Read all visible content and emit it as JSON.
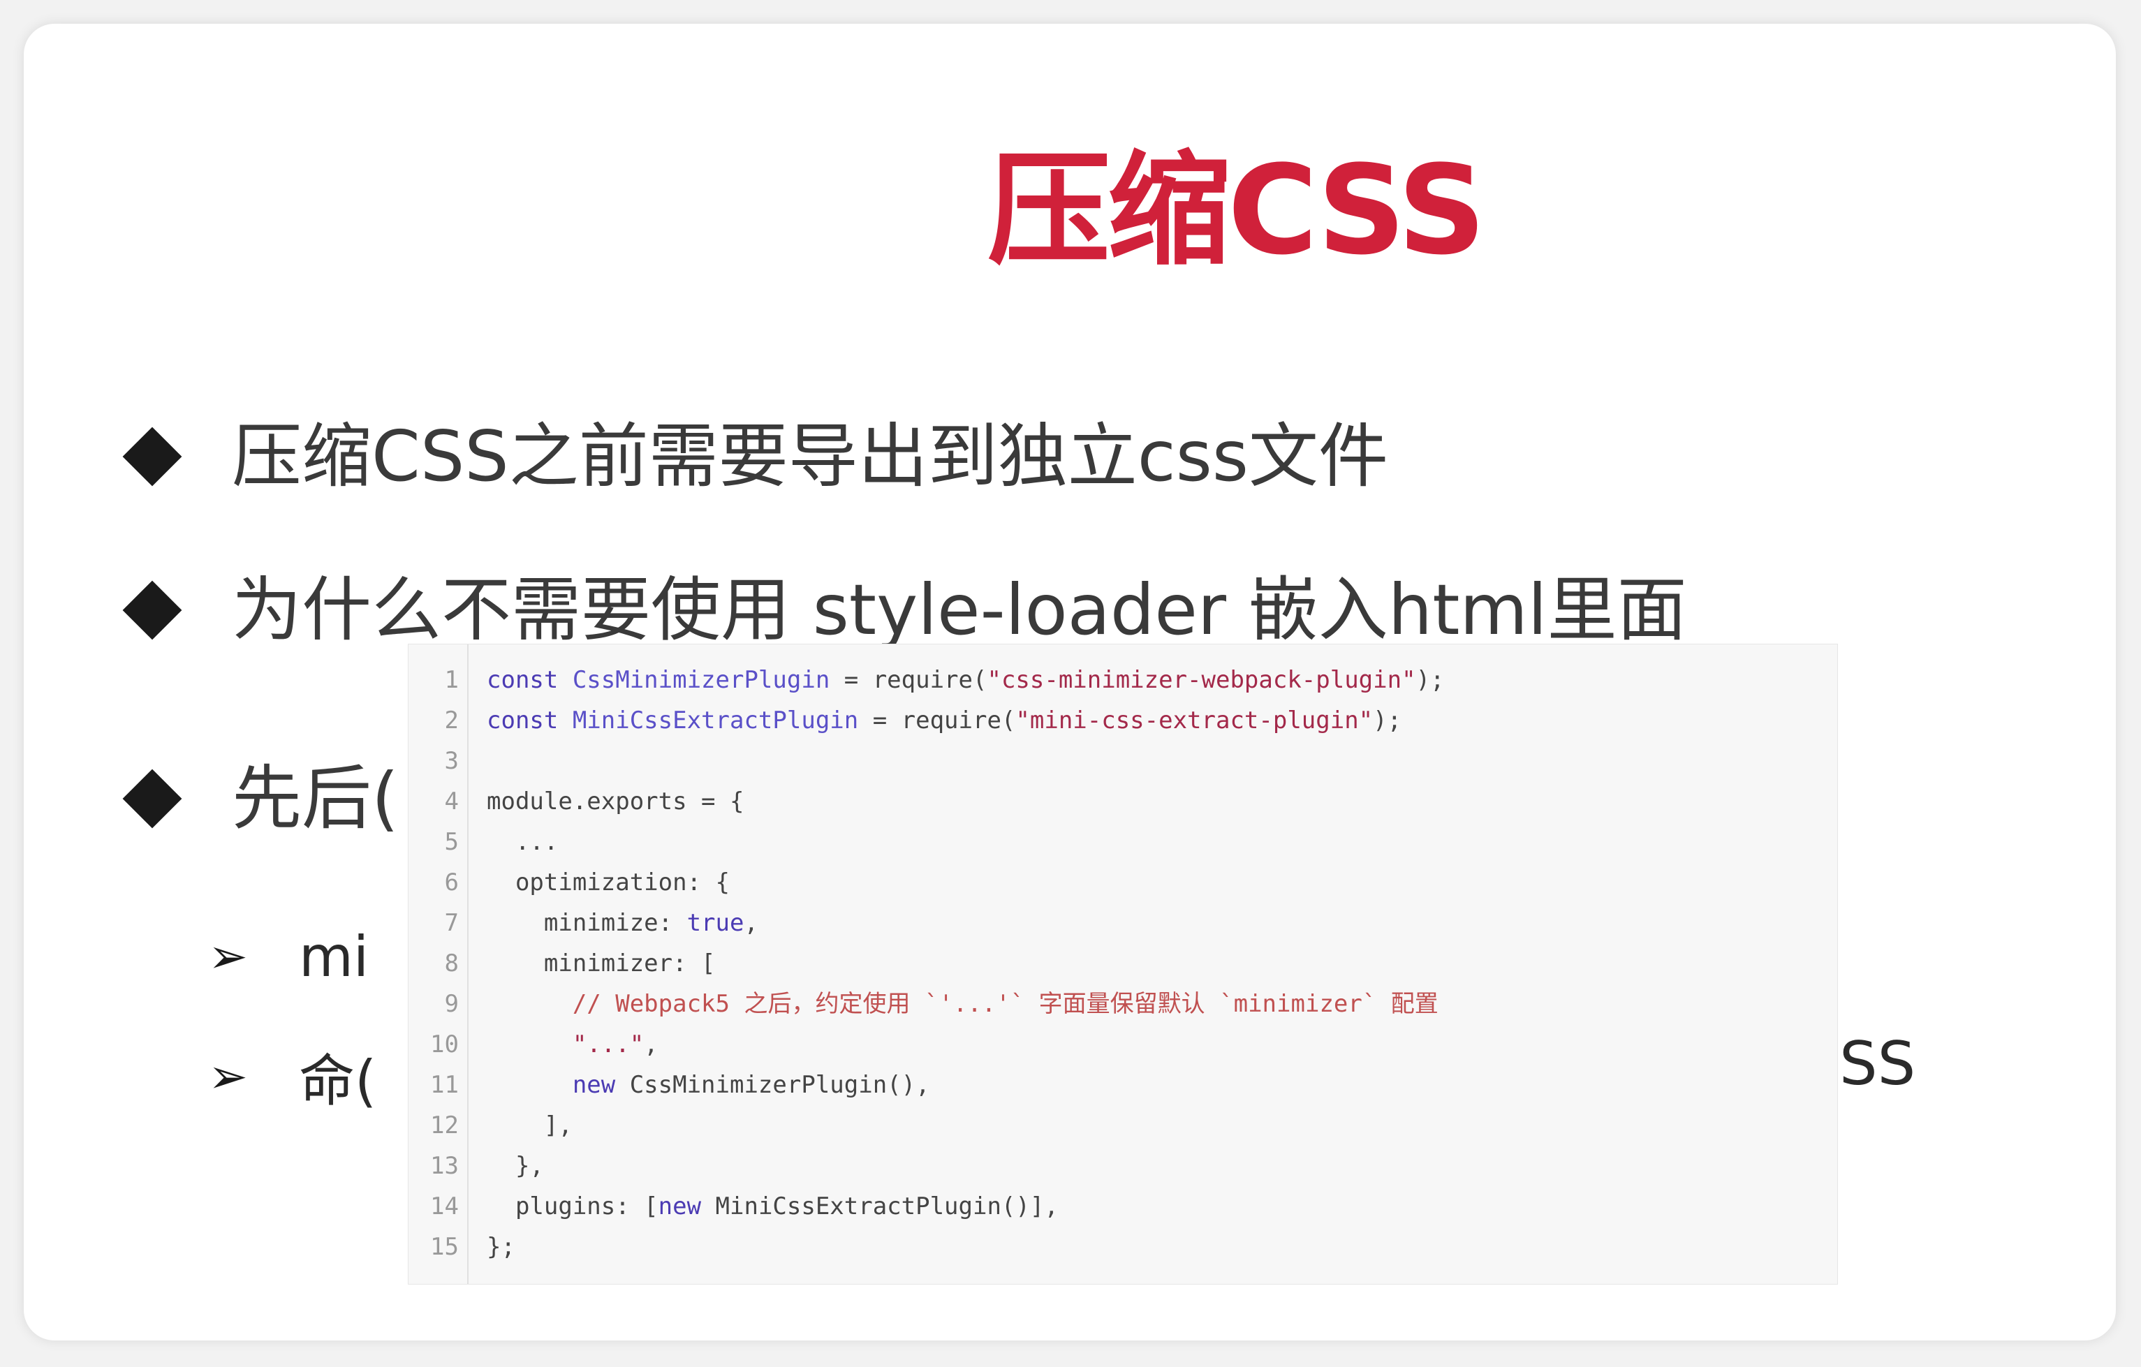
{
  "slide": {
    "title": "压缩CSS",
    "bullets": [
      {
        "text": "压缩CSS之前需要导出到独立css文件"
      },
      {
        "text": "为什么不需要使用 style-loader 嵌入html里面"
      },
      {
        "text": "先后("
      }
    ],
    "subbullets": [
      {
        "text": "mi"
      },
      {
        "text": "命("
      }
    ],
    "hidden_tail": "SS"
  },
  "code": {
    "lines": [
      {
        "n": "1",
        "parts": [
          [
            "kw",
            "const "
          ],
          [
            "cls",
            "CssMinimizerPlugin"
          ],
          [
            "punc",
            " = require("
          ],
          [
            "str",
            "\"css-minimizer-webpack-plugin\""
          ],
          [
            "punc",
            ");"
          ]
        ]
      },
      {
        "n": "2",
        "parts": [
          [
            "kw",
            "const "
          ],
          [
            "cls",
            "MiniCssExtractPlugin"
          ],
          [
            "punc",
            " = require("
          ],
          [
            "str",
            "\"mini-css-extract-plugin\""
          ],
          [
            "punc",
            ");"
          ]
        ]
      },
      {
        "n": "3",
        "parts": []
      },
      {
        "n": "4",
        "parts": [
          [
            "punc",
            "module.exports = {"
          ]
        ]
      },
      {
        "n": "5",
        "parts": [
          [
            "punc",
            "  ..."
          ]
        ]
      },
      {
        "n": "6",
        "parts": [
          [
            "punc",
            "  optimization: {"
          ]
        ]
      },
      {
        "n": "7",
        "parts": [
          [
            "punc",
            "    minimize: "
          ],
          [
            "bool",
            "true"
          ],
          [
            "punc",
            ","
          ]
        ]
      },
      {
        "n": "8",
        "parts": [
          [
            "punc",
            "    minimizer: ["
          ]
        ]
      },
      {
        "n": "9",
        "parts": [
          [
            "comment",
            "      // Webpack5 之后，约定使用 `'...'` 字面量保留默认 `minimizer` 配置"
          ]
        ]
      },
      {
        "n": "10",
        "parts": [
          [
            "str",
            "      \"...\""
          ],
          [
            "punc",
            ","
          ]
        ]
      },
      {
        "n": "11",
        "parts": [
          [
            "kw",
            "      new "
          ],
          [
            "punc",
            "CssMinimizerPlugin(),"
          ]
        ]
      },
      {
        "n": "12",
        "parts": [
          [
            "punc",
            "    ],"
          ]
        ]
      },
      {
        "n": "13",
        "parts": [
          [
            "punc",
            "  },"
          ]
        ]
      },
      {
        "n": "14",
        "parts": [
          [
            "punc",
            "  plugins: ["
          ],
          [
            "kw",
            "new "
          ],
          [
            "punc",
            "MiniCssExtractPlugin()],"
          ]
        ]
      },
      {
        "n": "15",
        "parts": [
          [
            "punc",
            "};"
          ]
        ]
      }
    ]
  },
  "colors": {
    "title": "#d0213a",
    "keyword": "#4b3bb3",
    "string": "#a3294a",
    "comment": "#c05050"
  }
}
